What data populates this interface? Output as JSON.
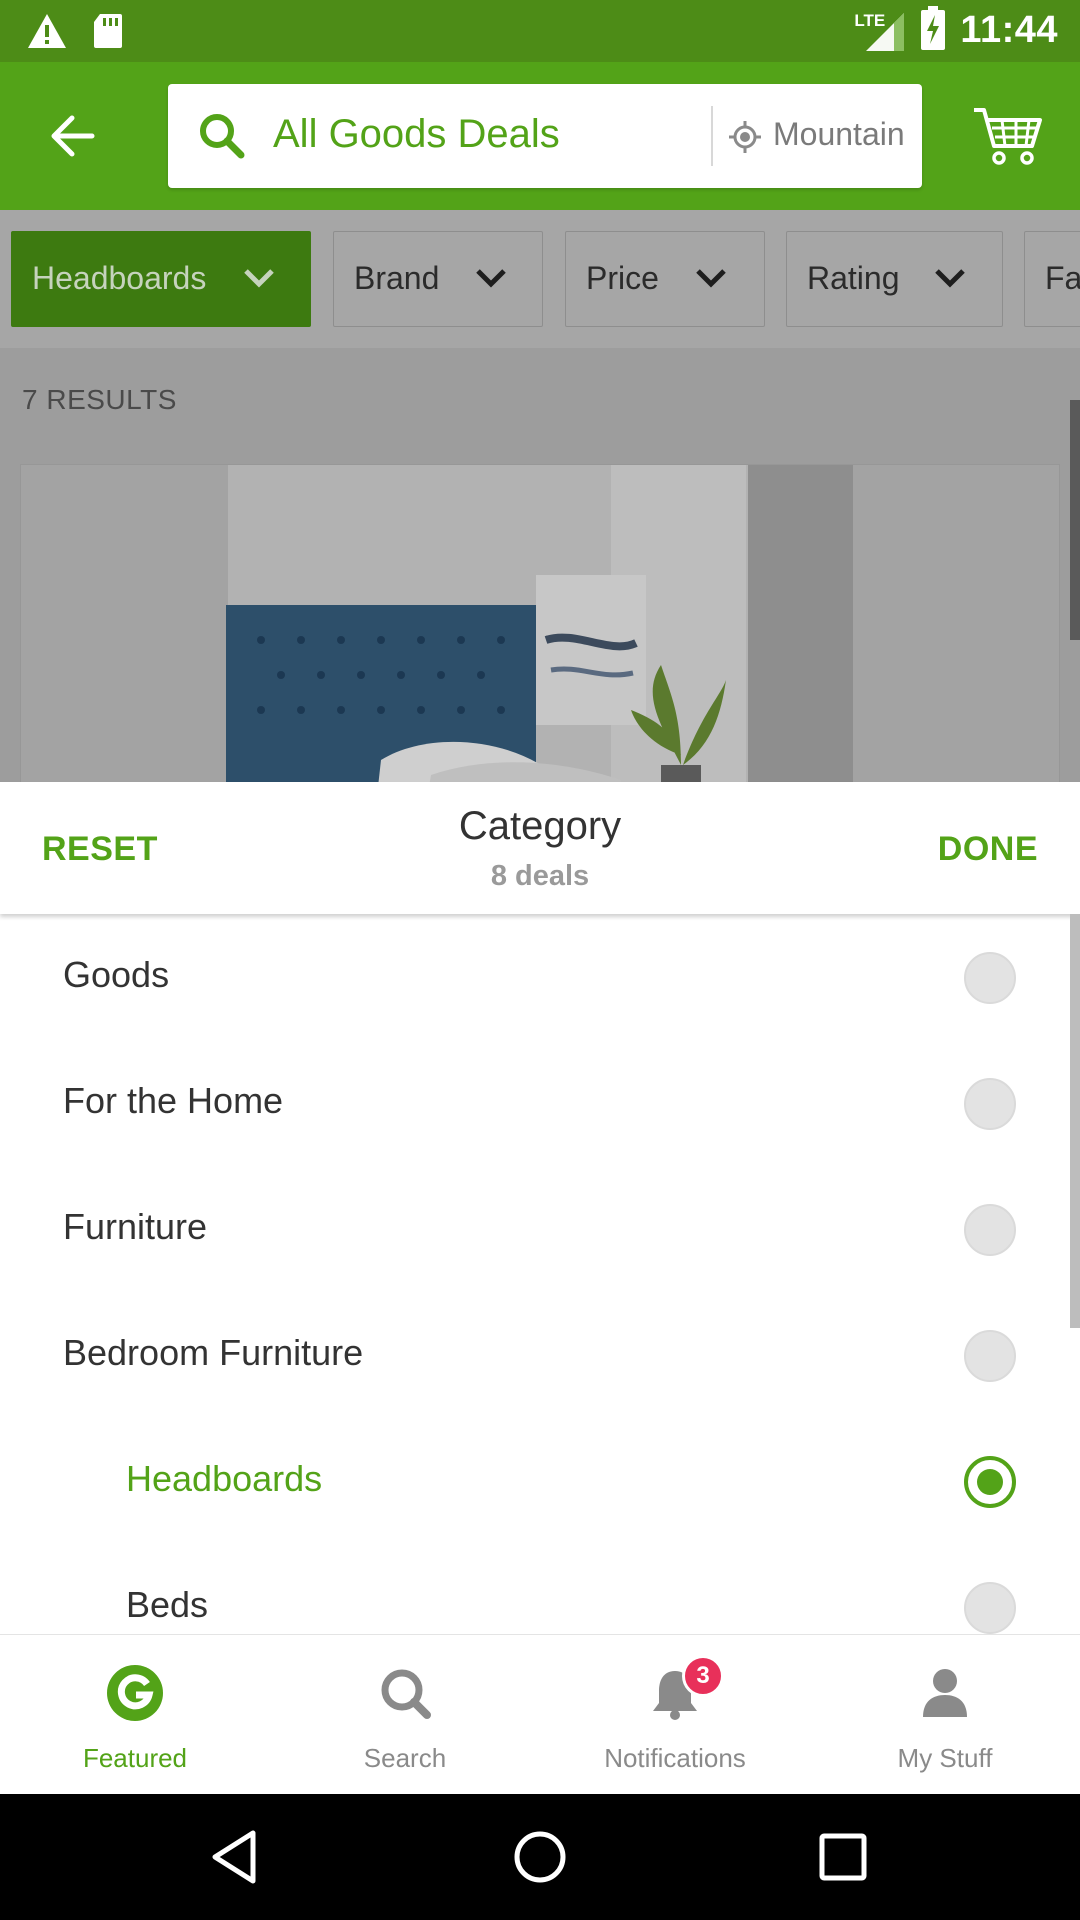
{
  "status_bar": {
    "time": "11:44",
    "network": "LTE",
    "icons": [
      "warning-icon",
      "sd-card-icon",
      "signal-icon",
      "battery-charging-icon"
    ]
  },
  "header": {
    "search_text": "All Goods Deals",
    "location_text": "Mountain"
  },
  "filters": [
    {
      "label": "Headboards",
      "active": true
    },
    {
      "label": "Brand",
      "active": false
    },
    {
      "label": "Price",
      "active": false
    },
    {
      "label": "Rating",
      "active": false
    },
    {
      "label": "Fa",
      "active": false
    }
  ],
  "results": {
    "count_text": "7 RESULTS"
  },
  "sheet": {
    "reset_label": "RESET",
    "title": "Category",
    "subtitle": "8 deals",
    "done_label": "DONE"
  },
  "categories": [
    {
      "label": "Goods",
      "selected": false
    },
    {
      "label": "For the Home",
      "selected": false
    },
    {
      "label": "Furniture",
      "selected": false
    },
    {
      "label": "Bedroom Furniture",
      "selected": false
    },
    {
      "label": "Headboards",
      "selected": true
    },
    {
      "label": "Beds",
      "selected": false
    }
  ],
  "bottom_nav": [
    {
      "label": "Featured",
      "icon": "groupon-g-icon",
      "active": true
    },
    {
      "label": "Search",
      "icon": "search-icon",
      "active": false
    },
    {
      "label": "Notifications",
      "icon": "bell-icon",
      "active": false,
      "badge": "3"
    },
    {
      "label": "My Stuff",
      "icon": "person-icon",
      "active": false
    }
  ],
  "colors": {
    "brand_green": "#53a318",
    "status_bar_green": "#4d8c17",
    "badge_red": "#e8305a"
  }
}
